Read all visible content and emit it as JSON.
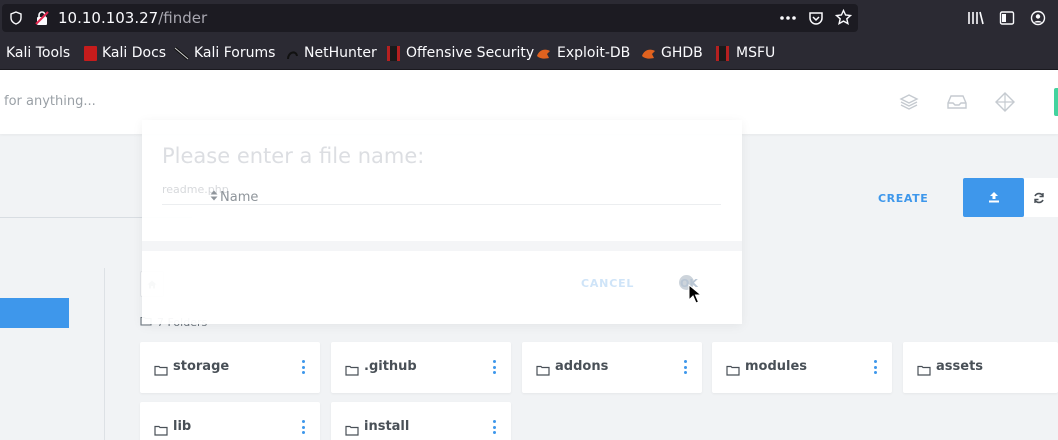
{
  "browser": {
    "url_host": "10.10.103.27",
    "url_path": "/finder",
    "bookmarks": [
      {
        "label": "Kali Tools"
      },
      {
        "label": "Kali Docs"
      },
      {
        "label": "Kali Forums"
      },
      {
        "label": "NetHunter"
      },
      {
        "label": "Offensive Security"
      },
      {
        "label": "Exploit-DB"
      },
      {
        "label": "GHDB"
      },
      {
        "label": "MSFU"
      }
    ]
  },
  "app": {
    "search_placeholder": "for anything...",
    "create_label": "CREATE",
    "folders_count_label": "7 Folders",
    "folders": [
      {
        "name": "storage"
      },
      {
        "name": ".github"
      },
      {
        "name": "addons"
      },
      {
        "name": "modules"
      },
      {
        "name": "assets"
      },
      {
        "name": "lib"
      },
      {
        "name": "install"
      }
    ]
  },
  "modal": {
    "title": "Please enter a file name:",
    "placeholder": "readme.php",
    "sort_label": "Name",
    "cancel_label": "CANCEL",
    "ok_label": "OK"
  },
  "colors": {
    "accent": "#3e97eb",
    "success": "#43d39e",
    "browser_chrome": "#2b2a33"
  }
}
